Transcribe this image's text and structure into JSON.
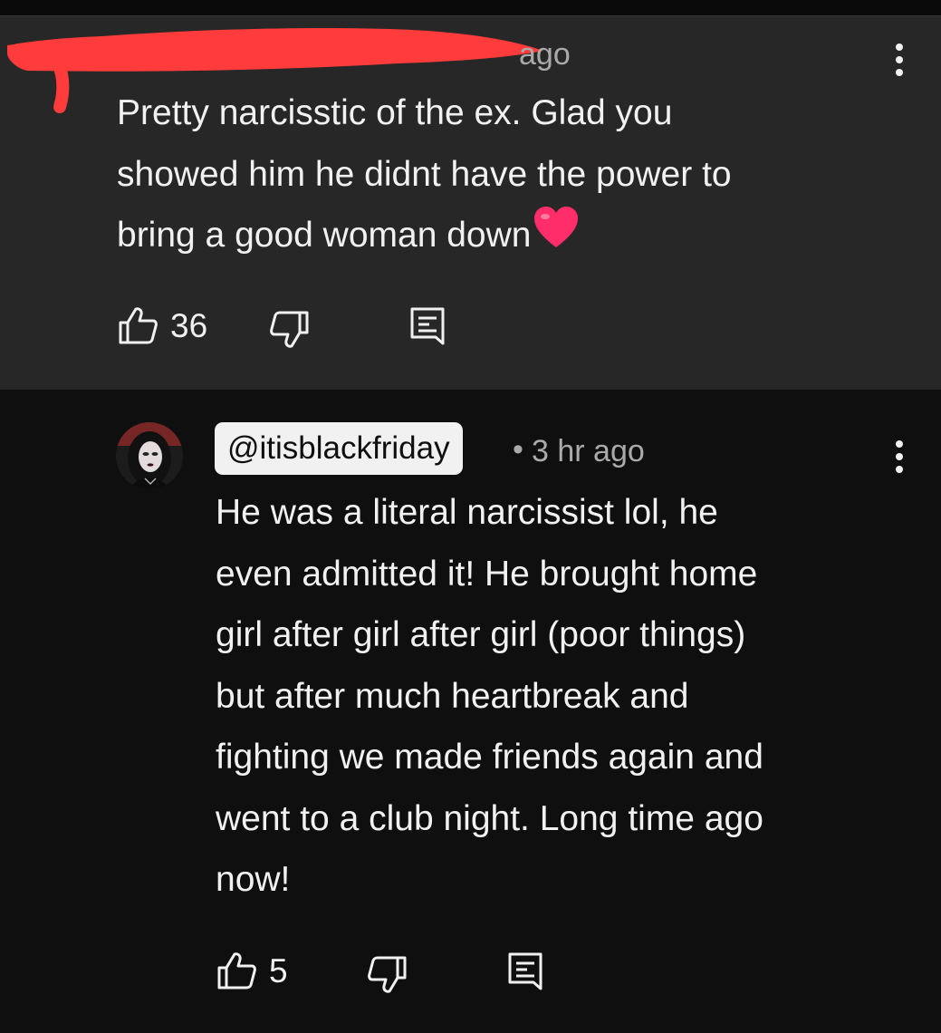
{
  "comment_1": {
    "time": "ago",
    "text": "Pretty narcisstic of the ex. Glad you\nshowed him he didnt have the power to\nbring a good woman down",
    "likes": "36"
  },
  "comment_2": {
    "handle": "@itisblackfriday",
    "separator": "•",
    "time": "3 hr ago",
    "text": "He was a literal narcissist lol, he\neven admitted it! He brought home\ngirl after girl after girl (poor things)\nbut after much heartbreak and\nfighting we made friends again and\nwent to a club night. Long time ago\nnow!",
    "likes": "5"
  },
  "icons": {
    "like": "thumbs-up-icon",
    "dislike": "thumbs-down-icon",
    "reply": "reply-comment-icon",
    "more": "more-vertical-icon",
    "reaction": "heart-emoji-icon"
  },
  "colors": {
    "background": "#0f0f0f",
    "highlighted_comment_bg": "#272727",
    "text": "#f1f1f1",
    "secondary_text": "#aaaaaa",
    "redaction": "#ff3b3b",
    "heart": "#ff2e6a"
  }
}
